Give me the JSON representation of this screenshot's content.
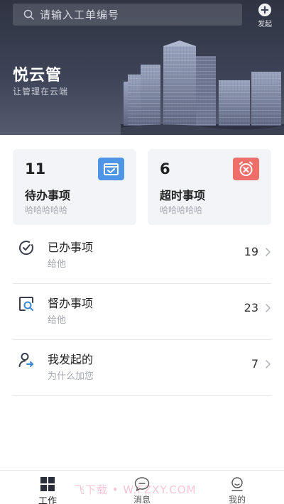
{
  "header": {
    "search_placeholder": "请输入工单编号",
    "launch_label": "发起",
    "brand_title": "悦云管",
    "brand_subtitle": "让管理在云端"
  },
  "cards": [
    {
      "count": "11",
      "title": "待办事项",
      "subtitle": "哈哈哈哈哈",
      "icon": "calendar-check-icon",
      "color": "#4e95e8"
    },
    {
      "count": "6",
      "title": "超时事项",
      "subtitle": "哈哈哈哈哈",
      "icon": "alarm-clock-x-icon",
      "color": "#ef6e6a"
    }
  ],
  "list": [
    {
      "title": "已办事项",
      "subtitle": "给他",
      "count": "19",
      "icon": "check-circle-icon"
    },
    {
      "title": "督办事项",
      "subtitle": "给他",
      "count": "23",
      "icon": "supervise-search-icon"
    },
    {
      "title": "我发起的",
      "subtitle": "为什么加您",
      "count": "7",
      "icon": "user-send-icon"
    }
  ],
  "bottom_nav": [
    {
      "label": "工作",
      "icon": "grid-icon",
      "active": true
    },
    {
      "label": "消息",
      "icon": "chat-bubble-icon",
      "active": false
    },
    {
      "label": "我的",
      "icon": "profile-icon",
      "active": false
    }
  ],
  "watermark": "飞下载 • W.FZXY.COM"
}
